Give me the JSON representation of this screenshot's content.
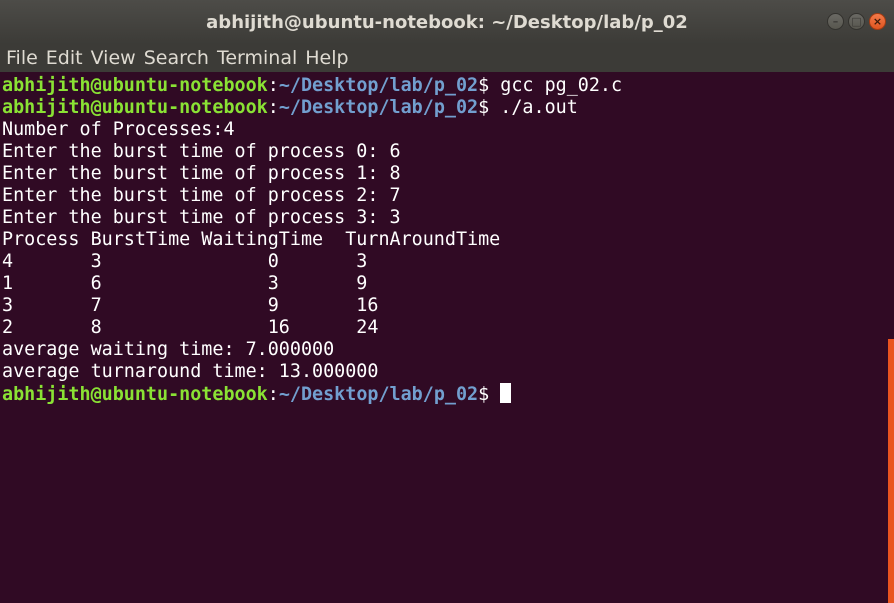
{
  "window": {
    "title": "abhijith@ubuntu-notebook: ~/Desktop/lab/p_02"
  },
  "window_controls": {
    "minimize": "–",
    "maximize": "□",
    "close": "×"
  },
  "menu": [
    "File",
    "Edit",
    "View",
    "Search",
    "Terminal",
    "Help"
  ],
  "terminal": {
    "user_host": "abhijith@ubuntu-notebook",
    "path": "~/Desktop/lab/p_02",
    "prompt_sep": ":",
    "prompt_end": "$ ",
    "commands": [
      "gcc pg_02.c",
      "./a.out"
    ],
    "output": [
      "Number of Processes:4",
      "Enter the burst time of process 0: 6",
      "Enter the burst time of process 1: 8",
      "Enter the burst time of process 2: 7",
      "Enter the burst time of process 3: 3",
      "Process BurstTime WaitingTime  TurnAroundTime",
      "4       3               0       3",
      "1       6               3       9",
      "3       7               9       16",
      "2       8               16      24",
      "average waiting time: 7.000000",
      "average turnaround time: 13.000000"
    ]
  },
  "colors": {
    "background": "#300a24",
    "user": "#8ae234",
    "path": "#729fcf",
    "accent": "#e95420"
  }
}
